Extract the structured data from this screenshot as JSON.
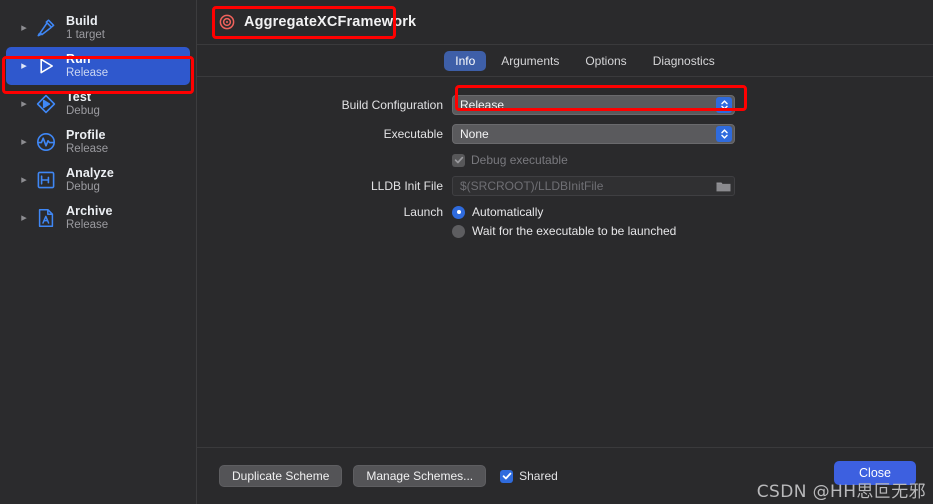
{
  "window": {
    "scheme_name": "AggregateXCFramework",
    "scheme_icon": "target-icon"
  },
  "sidebar": {
    "items": [
      {
        "label": "Build",
        "sub": "1 target",
        "icon": "hammer-icon",
        "selected": false
      },
      {
        "label": "Run",
        "sub": "Release",
        "icon": "play-icon",
        "selected": true
      },
      {
        "label": "Test",
        "sub": "Debug",
        "icon": "diamond-play-icon",
        "selected": false
      },
      {
        "label": "Profile",
        "sub": "Release",
        "icon": "waveform-icon",
        "selected": false
      },
      {
        "label": "Analyze",
        "sub": "Debug",
        "icon": "analyze-icon",
        "selected": false
      },
      {
        "label": "Archive",
        "sub": "Release",
        "icon": "archive-icon",
        "selected": false
      }
    ]
  },
  "tabs": [
    {
      "label": "Info",
      "active": true
    },
    {
      "label": "Arguments",
      "active": false
    },
    {
      "label": "Options",
      "active": false
    },
    {
      "label": "Diagnostics",
      "active": false
    }
  ],
  "form": {
    "build_configuration": {
      "label": "Build Configuration",
      "value": "Release"
    },
    "executable": {
      "label": "Executable",
      "value": "None"
    },
    "debug_executable": {
      "label": "Debug executable",
      "checked": true,
      "enabled": false
    },
    "lldb_init_file": {
      "label": "LLDB Init File",
      "placeholder": "$(SRCROOT)/LLDBInitFile",
      "value": ""
    },
    "launch": {
      "label": "Launch",
      "options": [
        {
          "label": "Automatically",
          "selected": true
        },
        {
          "label": "Wait for the executable to be launched",
          "selected": false
        }
      ]
    }
  },
  "footer": {
    "duplicate_scheme": "Duplicate Scheme",
    "manage_schemes": "Manage Schemes...",
    "shared_label": "Shared",
    "shared_checked": true,
    "close": "Close"
  },
  "watermark": "CSDN @HH思叵无邪",
  "colors": {
    "accent_blue": "#2f6bdd",
    "selection_blue": "#2f58cd",
    "annotation_red": "#ff0000",
    "panel_bg": "#2a2a2c",
    "sidebar_bg": "#2b2b2d"
  }
}
